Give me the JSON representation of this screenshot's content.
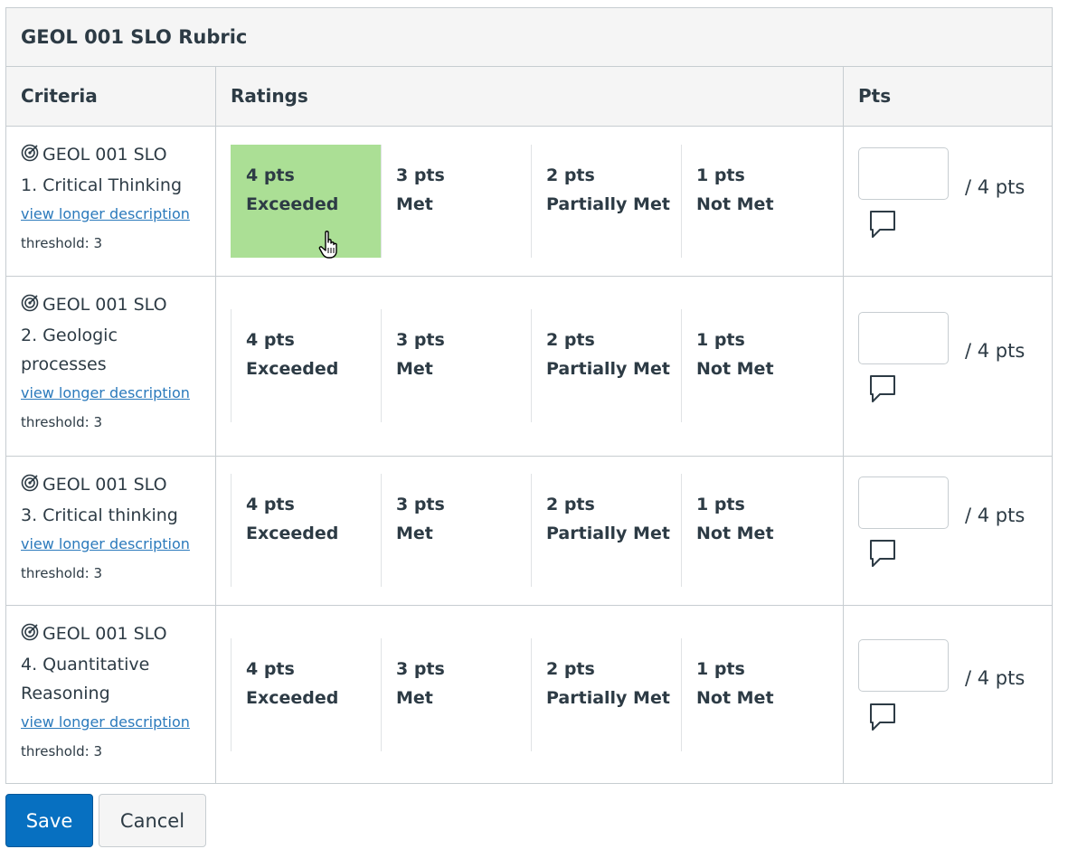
{
  "rubric": {
    "title": "GEOL 001 SLO Rubric",
    "headers": {
      "criteria": "Criteria",
      "ratings": "Ratings",
      "pts": "Pts"
    },
    "criteria": [
      {
        "line1": "GEOL 001 SLO",
        "line2": "1. Critical Thinking",
        "line3": "",
        "link": "view longer description",
        "threshold": "threshold: 3",
        "ratings": [
          {
            "pts": "4 pts",
            "desc": "Exceeded",
            "selected": true
          },
          {
            "pts": "3 pts",
            "desc": "Met",
            "selected": false
          },
          {
            "pts": "2 pts",
            "desc": "Partially Met",
            "selected": false
          },
          {
            "pts": "1 pts",
            "desc": "Not Met",
            "selected": false
          }
        ],
        "points_value": "",
        "points_total": "/ 4 pts"
      },
      {
        "line1": "GEOL 001 SLO",
        "line2": "2. Geologic",
        "line3": "processes",
        "link": "view longer description",
        "threshold": "threshold: 3",
        "ratings": [
          {
            "pts": "4 pts",
            "desc": "Exceeded",
            "selected": false
          },
          {
            "pts": "3 pts",
            "desc": "Met",
            "selected": false
          },
          {
            "pts": "2 pts",
            "desc": "Partially Met",
            "selected": false
          },
          {
            "pts": "1 pts",
            "desc": "Not Met",
            "selected": false
          }
        ],
        "points_value": "",
        "points_total": "/ 4 pts"
      },
      {
        "line1": "GEOL 001 SLO",
        "line2": "3. Critical thinking",
        "line3": "",
        "link": "view longer description",
        "threshold": "threshold: 3",
        "ratings": [
          {
            "pts": "4 pts",
            "desc": "Exceeded",
            "selected": false
          },
          {
            "pts": "3 pts",
            "desc": "Met",
            "selected": false
          },
          {
            "pts": "2 pts",
            "desc": "Partially Met",
            "selected": false
          },
          {
            "pts": "1 pts",
            "desc": "Not Met",
            "selected": false
          }
        ],
        "points_value": "",
        "points_total": "/ 4 pts"
      },
      {
        "line1": "GEOL 001 SLO",
        "line2": "4. Quantitative",
        "line3": "Reasoning",
        "link": "view longer description",
        "threshold": "threshold: 3",
        "ratings": [
          {
            "pts": "4 pts",
            "desc": "Exceeded",
            "selected": false
          },
          {
            "pts": "3 pts",
            "desc": "Met",
            "selected": false
          },
          {
            "pts": "2 pts",
            "desc": "Partially Met",
            "selected": false
          },
          {
            "pts": "1 pts",
            "desc": "Not Met",
            "selected": false
          }
        ],
        "points_value": "",
        "points_total": "/ 4 pts"
      }
    ]
  },
  "icons": {
    "outcome": "outcome-target-icon",
    "comment": "comment-bubble-icon",
    "cursor": "hand-pointer-cursor-icon"
  },
  "colors": {
    "selected_rating": "#abdf95",
    "primary_button": "#0770c1",
    "link": "#2b7abc",
    "border": "#c7cdd1",
    "header_bg": "#f5f5f5"
  },
  "actions": {
    "save_label": "Save",
    "cancel_label": "Cancel"
  }
}
